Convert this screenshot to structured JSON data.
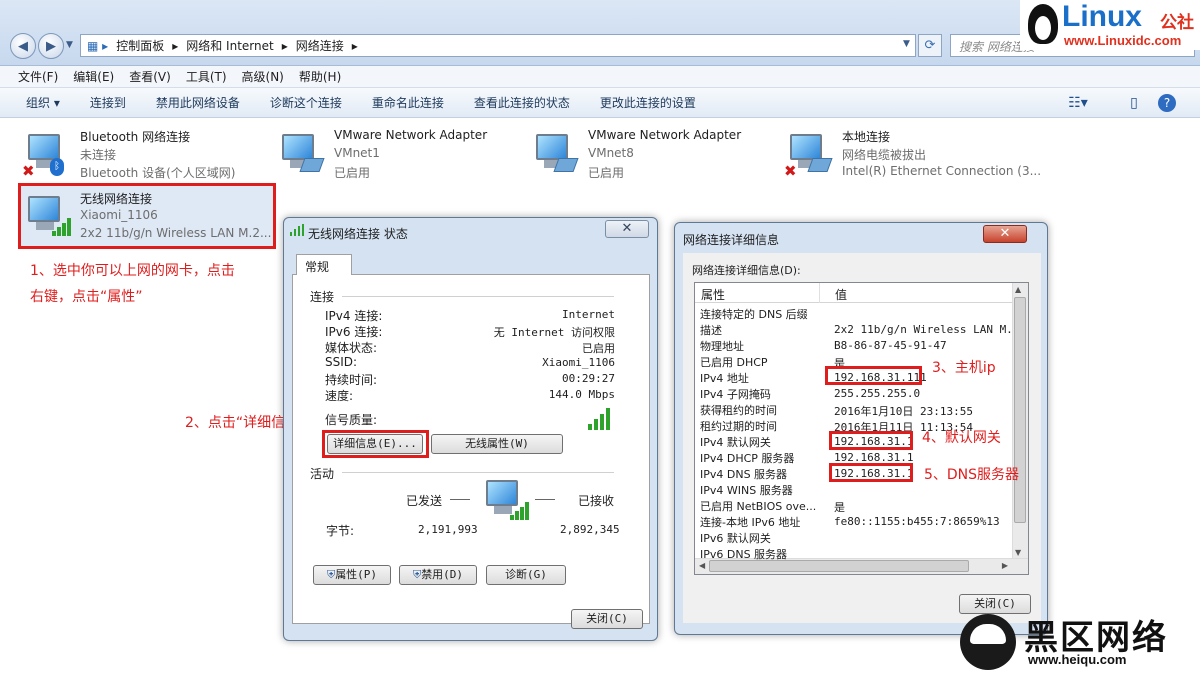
{
  "window": {
    "breadcrumb": [
      "控制面板",
      "网络和 Internet",
      "网络连接"
    ],
    "search_placeholder": "搜索 网络连接"
  },
  "logo_top": {
    "big": "Linux",
    "cn": "公社",
    "url": "www.Linuxidc.com"
  },
  "logo_bottom": {
    "big": "黑区网络",
    "url": "www.heiqu.com"
  },
  "menu": [
    "文件(F)",
    "编辑(E)",
    "查看(V)",
    "工具(T)",
    "高级(N)",
    "帮助(H)"
  ],
  "commands": [
    "组织 ▾",
    "连接到",
    "禁用此网络设备",
    "诊断这个连接",
    "重命名此连接",
    "查看此连接的状态",
    "更改此连接的设置"
  ],
  "adapters": [
    {
      "title": "Bluetooth 网络连接",
      "line1": "未连接",
      "line2": "Bluetooth 设备(个人区域网)"
    },
    {
      "title": "VMware Network Adapter",
      "line1": "VMnet1",
      "line2": "已启用"
    },
    {
      "title": "VMware Network Adapter",
      "line1": "VMnet8",
      "line2": "已启用"
    },
    {
      "title": "本地连接",
      "line1": "网络电缆被拔出",
      "line2": "Intel(R) Ethernet Connection (3..."
    },
    {
      "title": "无线网络连接",
      "line1": "Xiaomi_1106",
      "line2": "2x2 11b/g/n Wireless LAN M.2..."
    }
  ],
  "notes": {
    "n1a": "1、选中你可以上网的网卡，点击",
    "n1b": "右键，点击“属性”",
    "n2": "2、点击“详细信息”",
    "n3": "3、主机ip",
    "n4": "4、默认网关",
    "n5": "5、DNS服务器"
  },
  "status_dialog": {
    "title": "无线网络连接 状态",
    "tab": "常规",
    "group_connection": "连接",
    "rows": [
      {
        "label": "IPv4 连接:",
        "value": "Internet"
      },
      {
        "label": "IPv6 连接:",
        "value": "无 Internet 访问权限"
      },
      {
        "label": "媒体状态:",
        "value": "已启用"
      },
      {
        "label": "SSID:",
        "value": "Xiaomi_1106"
      },
      {
        "label": "持续时间:",
        "value": "00:29:27"
      },
      {
        "label": "速度:",
        "value": "144.0 Mbps"
      }
    ],
    "signal_label": "信号质量:",
    "details_btn": "详细信息(E)...",
    "wireless_btn": "无线属性(W)",
    "group_activity": "活动",
    "sent_label": "已发送",
    "recv_label": "已接收",
    "bytes_label": "字节:",
    "sent_bytes": "2,191,993",
    "recv_bytes": "2,892,345",
    "props_btn": "属性(P)",
    "disable_btn": "禁用(D)",
    "diagnose_btn": "诊断(G)",
    "close_btn": "关闭(C)"
  },
  "details_dialog": {
    "title": "网络连接详细信息",
    "list_caption": "网络连接详细信息(D):",
    "col_prop": "属性",
    "col_val": "值",
    "rows": [
      {
        "p": "连接特定的 DNS 后缀",
        "v": ""
      },
      {
        "p": "描述",
        "v": "2x2 11b/g/n Wireless LAN M.2 A"
      },
      {
        "p": "物理地址",
        "v": "B8-86-87-45-91-47"
      },
      {
        "p": "已启用 DHCP",
        "v": "是"
      },
      {
        "p": "IPv4 地址",
        "v": "192.168.31.111"
      },
      {
        "p": "IPv4 子网掩码",
        "v": "255.255.255.0"
      },
      {
        "p": "获得租约的时间",
        "v": "2016年1月10日 23:13:55"
      },
      {
        "p": "租约过期的时间",
        "v": "2016年1月11日 11:13:54"
      },
      {
        "p": "IPv4 默认网关",
        "v": "192.168.31.1"
      },
      {
        "p": "IPv4 DHCP 服务器",
        "v": "192.168.31.1"
      },
      {
        "p": "IPv4 DNS 服务器",
        "v": "192.168.31.1"
      },
      {
        "p": "IPv4 WINS 服务器",
        "v": ""
      },
      {
        "p": "已启用 NetBIOS ove...",
        "v": "是"
      },
      {
        "p": "连接-本地 IPv6 地址",
        "v": "fe80::1155:b455:7:8659%13"
      },
      {
        "p": "IPv6 默认网关",
        "v": ""
      },
      {
        "p": "IPv6 DNS 服务器",
        "v": ""
      }
    ],
    "close_btn": "关闭(C)"
  }
}
